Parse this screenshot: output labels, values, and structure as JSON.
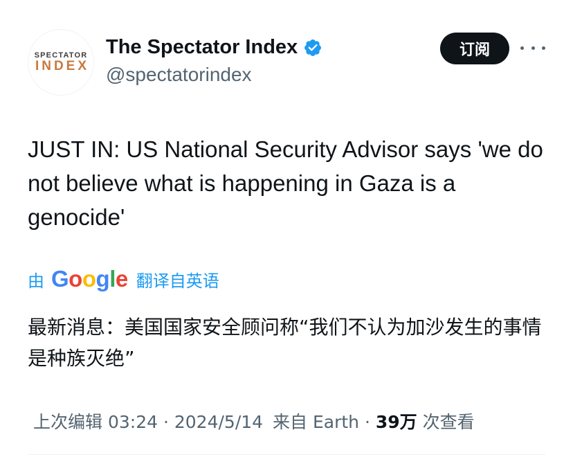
{
  "author": {
    "avatar_line1": "SPECTATOR",
    "avatar_line2": "INDEX",
    "display_name": "The Spectator Index",
    "handle": "@spectatorindex",
    "verified_icon": "verified-badge-icon",
    "verified_color": "#1d9bf0"
  },
  "header": {
    "subscribe_label": "订阅",
    "more_icon": "more-horizontal-icon"
  },
  "tweet": {
    "text": "JUST IN: US National Security Advisor says 'we do not believe what is happening in Gaza is a genocide'"
  },
  "translation": {
    "prefix": "由",
    "google_logo": "Google",
    "suffix": "翻译自英语",
    "text": "最新消息：美国国家安全顾问称“我们不认为加沙发生的事情是种族灭绝”",
    "link_color": "#1d9bf0"
  },
  "meta": {
    "edited_label": "上次编辑",
    "time": "03:24",
    "date": "2024/5/14",
    "source_prefix": "来自",
    "source": "Earth",
    "views_count": "39万",
    "views_label": "次查看",
    "separator": "·"
  }
}
